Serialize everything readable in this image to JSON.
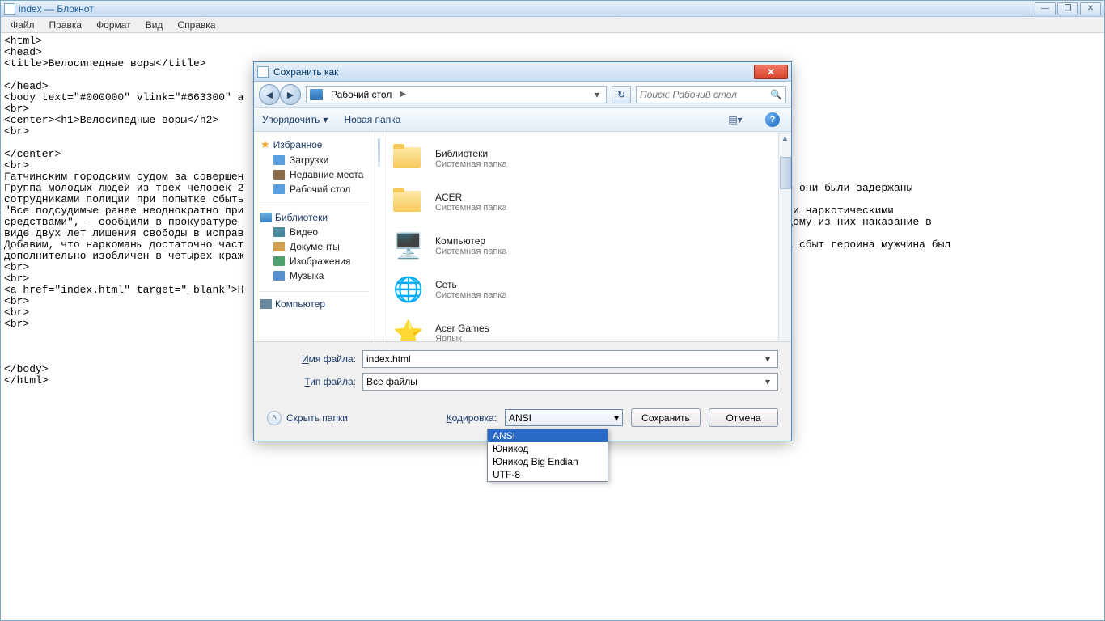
{
  "notepad": {
    "title": "index — Блокнот",
    "menu": [
      "Файл",
      "Правка",
      "Формат",
      "Вид",
      "Справка"
    ],
    "content": "<html>\n<head>\n<title>Велосипедные воры</title>\n\n</head>\n<body text=\"#000000\" vlink=\"#663300\" a\n<br>\n<center><h1>Велосипедные воры</h2>\n<br>\n\n</center>\n<br>\nГатчинским городским судом за совершен                                                                     и.\nГруппа молодых людей из трех человек 2                                                                     \"Аэродром\". Вскоре они были задержаны\nсотрудниками полиции при попытке сбыть                                                                     евшему.\n\"Все подсудимые ранее неоднократно при                                                                     ы в злоупотреблении наркотическими\nсредствами\", - сообщили в прокуратуре                                                                      суд определил каждому из них наказание в\nвиде двух лет лишения свободы в исправ\nДобавим, что наркоманы достаточно част                                                                     ице задержанный за сбыт героина мужчина был\nдополнительно изобличен в четырех краж                                                                     имый мужчина.\n<br>\n<br>\n<a href=\"index.html\" target=\"_blank\">Н\n<br>\n<br>\n<br>\n\n\n\n</body>\n</html>"
  },
  "dialog": {
    "title": "Сохранить как",
    "path_segment": "Рабочий стол",
    "search_placeholder": "Поиск: Рабочий стол",
    "toolbar": {
      "organize": "Упорядочить",
      "new_folder": "Новая папка"
    },
    "nav": {
      "favorites": "Избранное",
      "fav_items": [
        "Загрузки",
        "Недавние места",
        "Рабочий стол"
      ],
      "libraries": "Библиотеки",
      "lib_items": [
        "Видео",
        "Документы",
        "Изображения",
        "Музыка"
      ],
      "computer": "Компьютер"
    },
    "items": [
      {
        "name": "Библиотеки",
        "sub": "Системная папка"
      },
      {
        "name": "ACER",
        "sub": "Системная папка"
      },
      {
        "name": "Компьютер",
        "sub": "Системная папка"
      },
      {
        "name": "Сеть",
        "sub": "Системная папка"
      },
      {
        "name": "Acer Games",
        "sub": "Ярлык"
      }
    ],
    "filename_label": "Имя файла:",
    "filename_value": "index.html",
    "filetype_label": "Тип файла:",
    "filetype_value": "Все файлы",
    "hide_folders": "Скрыть папки",
    "encoding_label": "Кодировка:",
    "encoding_value": "ANSI",
    "encoding_options": [
      "ANSI",
      "Юникод",
      "Юникод Big Endian",
      "UTF-8"
    ],
    "save_btn": "Сохранить",
    "cancel_btn": "Отмена"
  }
}
